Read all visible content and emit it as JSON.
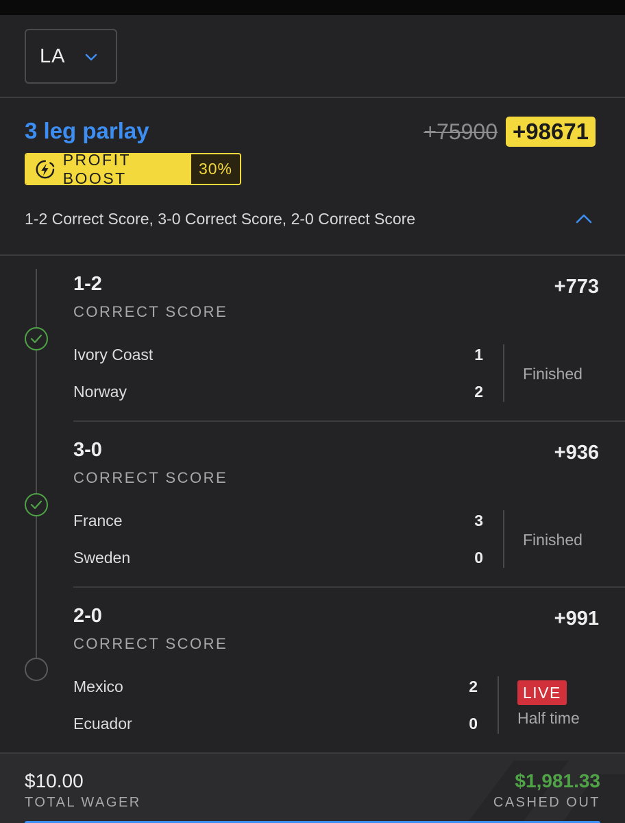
{
  "state_selector": {
    "value": "LA",
    "icon": "chevron-down-icon"
  },
  "bet": {
    "title": "3 leg parlay",
    "original_odds": "+75900",
    "boosted_odds": "+98671",
    "boost": {
      "label": "PROFIT BOOST",
      "percent": "30%",
      "icon": "lightning-icon"
    },
    "legs_summary": "1-2 Correct Score, 3-0 Correct Score, 2-0 Correct Score",
    "collapse_icon": "chevron-up-icon"
  },
  "legs": [
    {
      "selection": "1-2",
      "market": "CORRECT SCORE",
      "odds": "+773",
      "result": "won",
      "teams": [
        {
          "name": "Ivory Coast",
          "score": "1"
        },
        {
          "name": "Norway",
          "score": "2"
        }
      ],
      "status": "Finished"
    },
    {
      "selection": "3-0",
      "market": "CORRECT SCORE",
      "odds": "+936",
      "result": "won",
      "teams": [
        {
          "name": "France",
          "score": "3"
        },
        {
          "name": "Sweden",
          "score": "0"
        }
      ],
      "status": "Finished"
    },
    {
      "selection": "2-0",
      "market": "CORRECT SCORE",
      "odds": "+991",
      "result": "pending",
      "teams": [
        {
          "name": "Mexico",
          "score": "2"
        },
        {
          "name": "Ecuador",
          "score": "0"
        }
      ],
      "live_label": "LIVE",
      "status": "Half time"
    }
  ],
  "footer": {
    "wager_amount": "$10.00",
    "wager_label": "TOTAL WAGER",
    "payout_amount": "$1,981.33",
    "payout_label": "CASHED OUT"
  },
  "colors": {
    "background": "#232325",
    "accent_blue": "#3d8ef2",
    "boost_yellow": "#f4d93c",
    "win_green": "#4fa346",
    "live_red": "#d1313a"
  }
}
